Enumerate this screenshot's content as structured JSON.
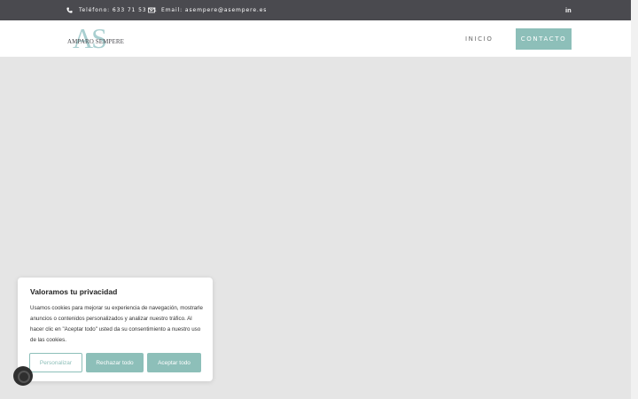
{
  "topbar": {
    "phone_label": "Teléfono: 633 71 53 71",
    "email_label": "Email: asempere@asempere.es",
    "linkedin_label": "in"
  },
  "header": {
    "logo_monogram": "AS",
    "logo_name": "AMPARO SEMPERE",
    "nav_inicio": "INICIO",
    "nav_contacto": "CONTACTO"
  },
  "cookie_banner": {
    "title": "Valoramos tu privacidad",
    "body": "Usamos cookies para mejorar su experiencia de navegación, mostrarle anuncios o contenidos personalizados y analizar nuestro tráfico. Al hacer clic en \"Aceptar todo\" usted da su consentimiento a nuestro uso de las cookies.",
    "customize_label": "Personalizar",
    "reject_label": "Rechazar todo",
    "accept_label": "Aceptar todo"
  },
  "icons": {
    "phone": "phone-icon",
    "email": "envelope-icon",
    "linkedin": "linkedin-icon",
    "revisit": "cookie-revisit-icon"
  },
  "colors": {
    "topbar_bg": "#4a4a4f",
    "accent": "#8dbfb9",
    "logo_accent": "#a9cfd0",
    "content_bg": "#e5e5e5"
  }
}
